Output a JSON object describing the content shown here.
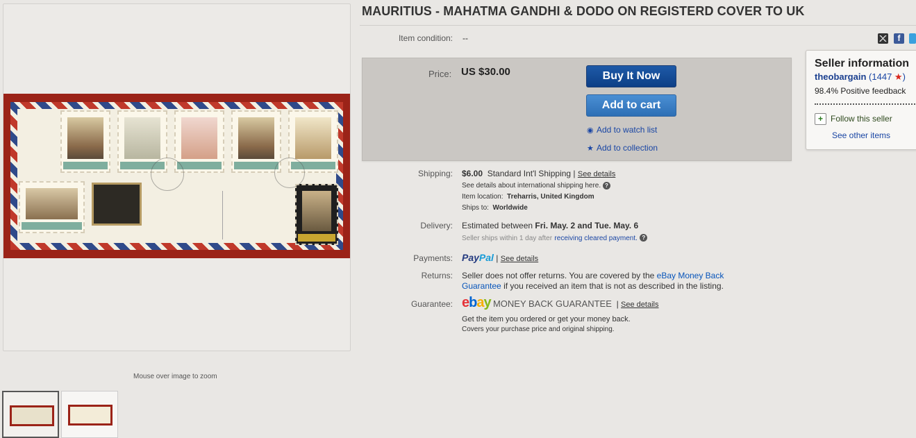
{
  "listing": {
    "title": "MAURITIUS - MAHATMA GANDHI & DODO ON REGISTERD COVER TO UK",
    "condition_label": "Item condition:",
    "condition_value": "--"
  },
  "gallery": {
    "zoom_hint": "Mouse over image to zoom"
  },
  "share": {
    "facebook_glyph": "f"
  },
  "buy_box": {
    "price_label": "Price:",
    "price_value": "US $30.00",
    "buy_now_label": "Buy It Now",
    "add_to_cart_label": "Add to cart",
    "watch_label": "Add to watch list",
    "collection_label": "Add to collection",
    "colors": {
      "buy_now": "#0d3f86",
      "add_to_cart": "#2d6fb5"
    }
  },
  "seller": {
    "heading": "Seller information",
    "username": "theobargain",
    "feedback_score": "1447",
    "positive_feedback": "98.4% Positive feedback",
    "follow_label": "Follow this seller",
    "other_items_label": "See other items"
  },
  "shipping": {
    "label": "Shipping:",
    "cost": "$6.00",
    "service": "Standard Int'l Shipping",
    "separator": "|",
    "see_details": "See details",
    "intl_note": "See details about international shipping here.",
    "location_label": "Item location:",
    "location_value": "Treharris, United Kingdom",
    "ships_to_label": "Ships to:",
    "ships_to_value": "Worldwide"
  },
  "delivery": {
    "label": "Delivery:",
    "estimate_prefix": "Estimated between",
    "estimate_range": "Fri. May. 2 and Tue. May. 6",
    "note_prefix": "Seller ships within 1 day after",
    "note_link": "receiving cleared payment."
  },
  "payments": {
    "label": "Payments:",
    "paypal_part1": "Pay",
    "paypal_part2": "Pal",
    "see_details": "See details"
  },
  "returns": {
    "label": "Returns:",
    "text_before": "Seller does not offer returns. You are covered by the",
    "link": "eBay Money Back Guarantee",
    "text_after": "if you received an item that is not as described in the listing."
  },
  "guarantee": {
    "label": "Guarantee:",
    "logo_letters": [
      "e",
      "b",
      "a",
      "y"
    ],
    "logo_text": "MONEY BACK GUARANTEE",
    "see_details": "See details",
    "line1": "Get the item you ordered or get your money back.",
    "line2": "Covers your purchase price and original shipping."
  }
}
